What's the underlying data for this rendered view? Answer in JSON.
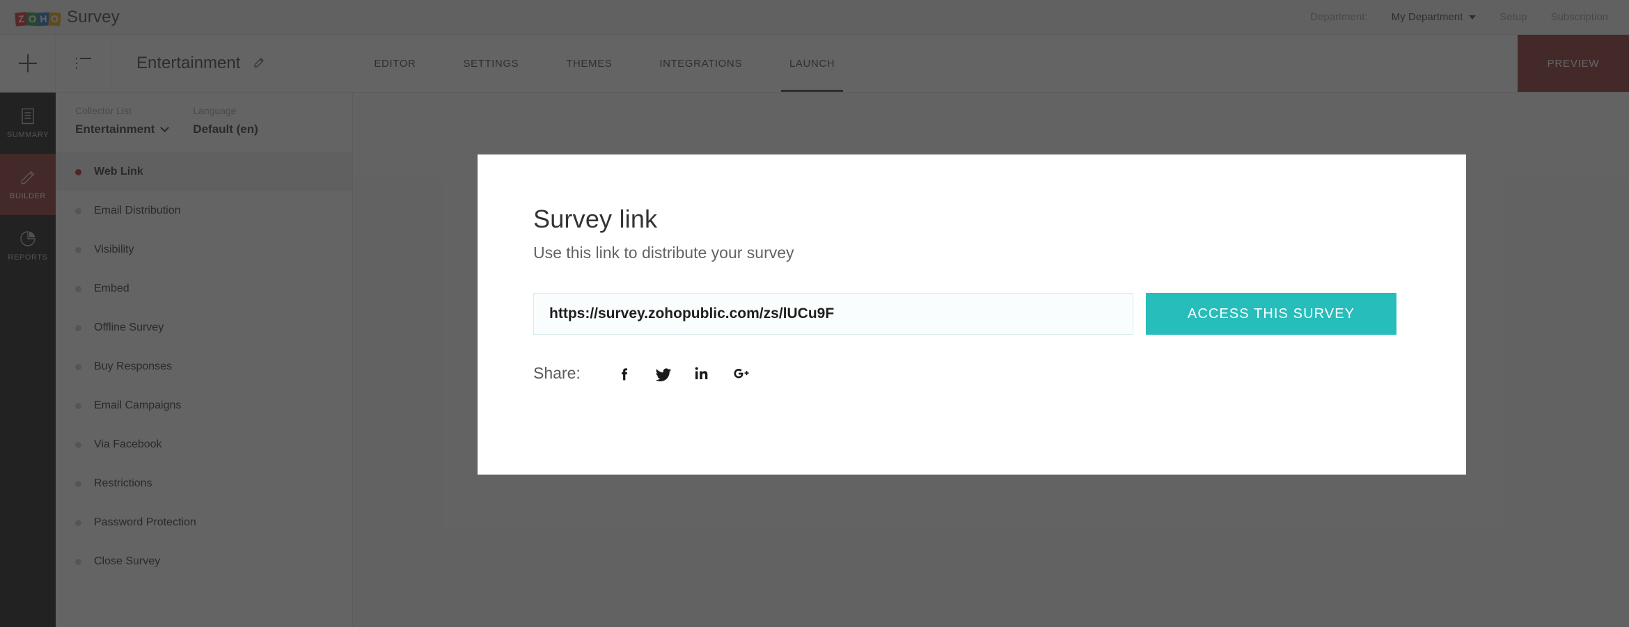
{
  "topbar": {
    "brand_name": "Survey",
    "logo_letters": [
      "Z",
      "O",
      "H",
      "O"
    ],
    "department_label": "Department:",
    "department_value": "My Department",
    "links": [
      "Setup",
      "Subscription"
    ]
  },
  "navbar": {
    "add_icon": "plus-icon",
    "list_icon": "list-icon",
    "survey_title": "Entertainment",
    "edit_icon": "pencil-icon",
    "tabs": [
      {
        "label": "EDITOR",
        "active": false
      },
      {
        "label": "SETTINGS",
        "active": false
      },
      {
        "label": "THEMES",
        "active": false
      },
      {
        "label": "INTEGRATIONS",
        "active": false
      },
      {
        "label": "LAUNCH",
        "active": true
      }
    ],
    "preview_label": "PREVIEW"
  },
  "rail": {
    "items": [
      {
        "label": "SUMMARY",
        "icon": "document-icon",
        "active": false
      },
      {
        "label": "BUILDER",
        "icon": "pencil-icon",
        "active": true
      },
      {
        "label": "REPORTS",
        "icon": "pie-chart-icon",
        "active": false
      }
    ]
  },
  "panel": {
    "collector_label": "Collector List",
    "collector_value": "Entertainment",
    "language_label": "Language",
    "language_value": "Default (en)",
    "items": [
      {
        "label": "Web Link",
        "active": true
      },
      {
        "label": "Email Distribution",
        "active": false
      },
      {
        "label": "Visibility",
        "active": false
      },
      {
        "label": "Embed",
        "active": false
      },
      {
        "label": "Offline Survey",
        "active": false
      },
      {
        "label": "Buy Responses",
        "active": false
      },
      {
        "label": "Email Campaigns",
        "active": false
      },
      {
        "label": "Via Facebook",
        "active": false
      },
      {
        "label": "Restrictions",
        "active": false
      },
      {
        "label": "Password Protection",
        "active": false
      },
      {
        "label": "Close Survey",
        "active": false
      }
    ]
  },
  "modal": {
    "title": "Survey link",
    "subtitle": "Use this link to distribute your survey",
    "link_value": "https://survey.zohopublic.com/zs/lUCu9F",
    "access_button": "ACCESS THIS SURVEY",
    "share_label": "Share:",
    "share_icons": [
      "facebook-icon",
      "twitter-icon",
      "linkedin-icon",
      "googleplus-icon"
    ]
  },
  "colors": {
    "accent_teal": "#27bdba",
    "accent_maroon": "#8c2e2e",
    "active_dot_red": "#a02121",
    "rail_dark": "#151515",
    "overlay": "rgba(40,40,40,0.72)"
  }
}
